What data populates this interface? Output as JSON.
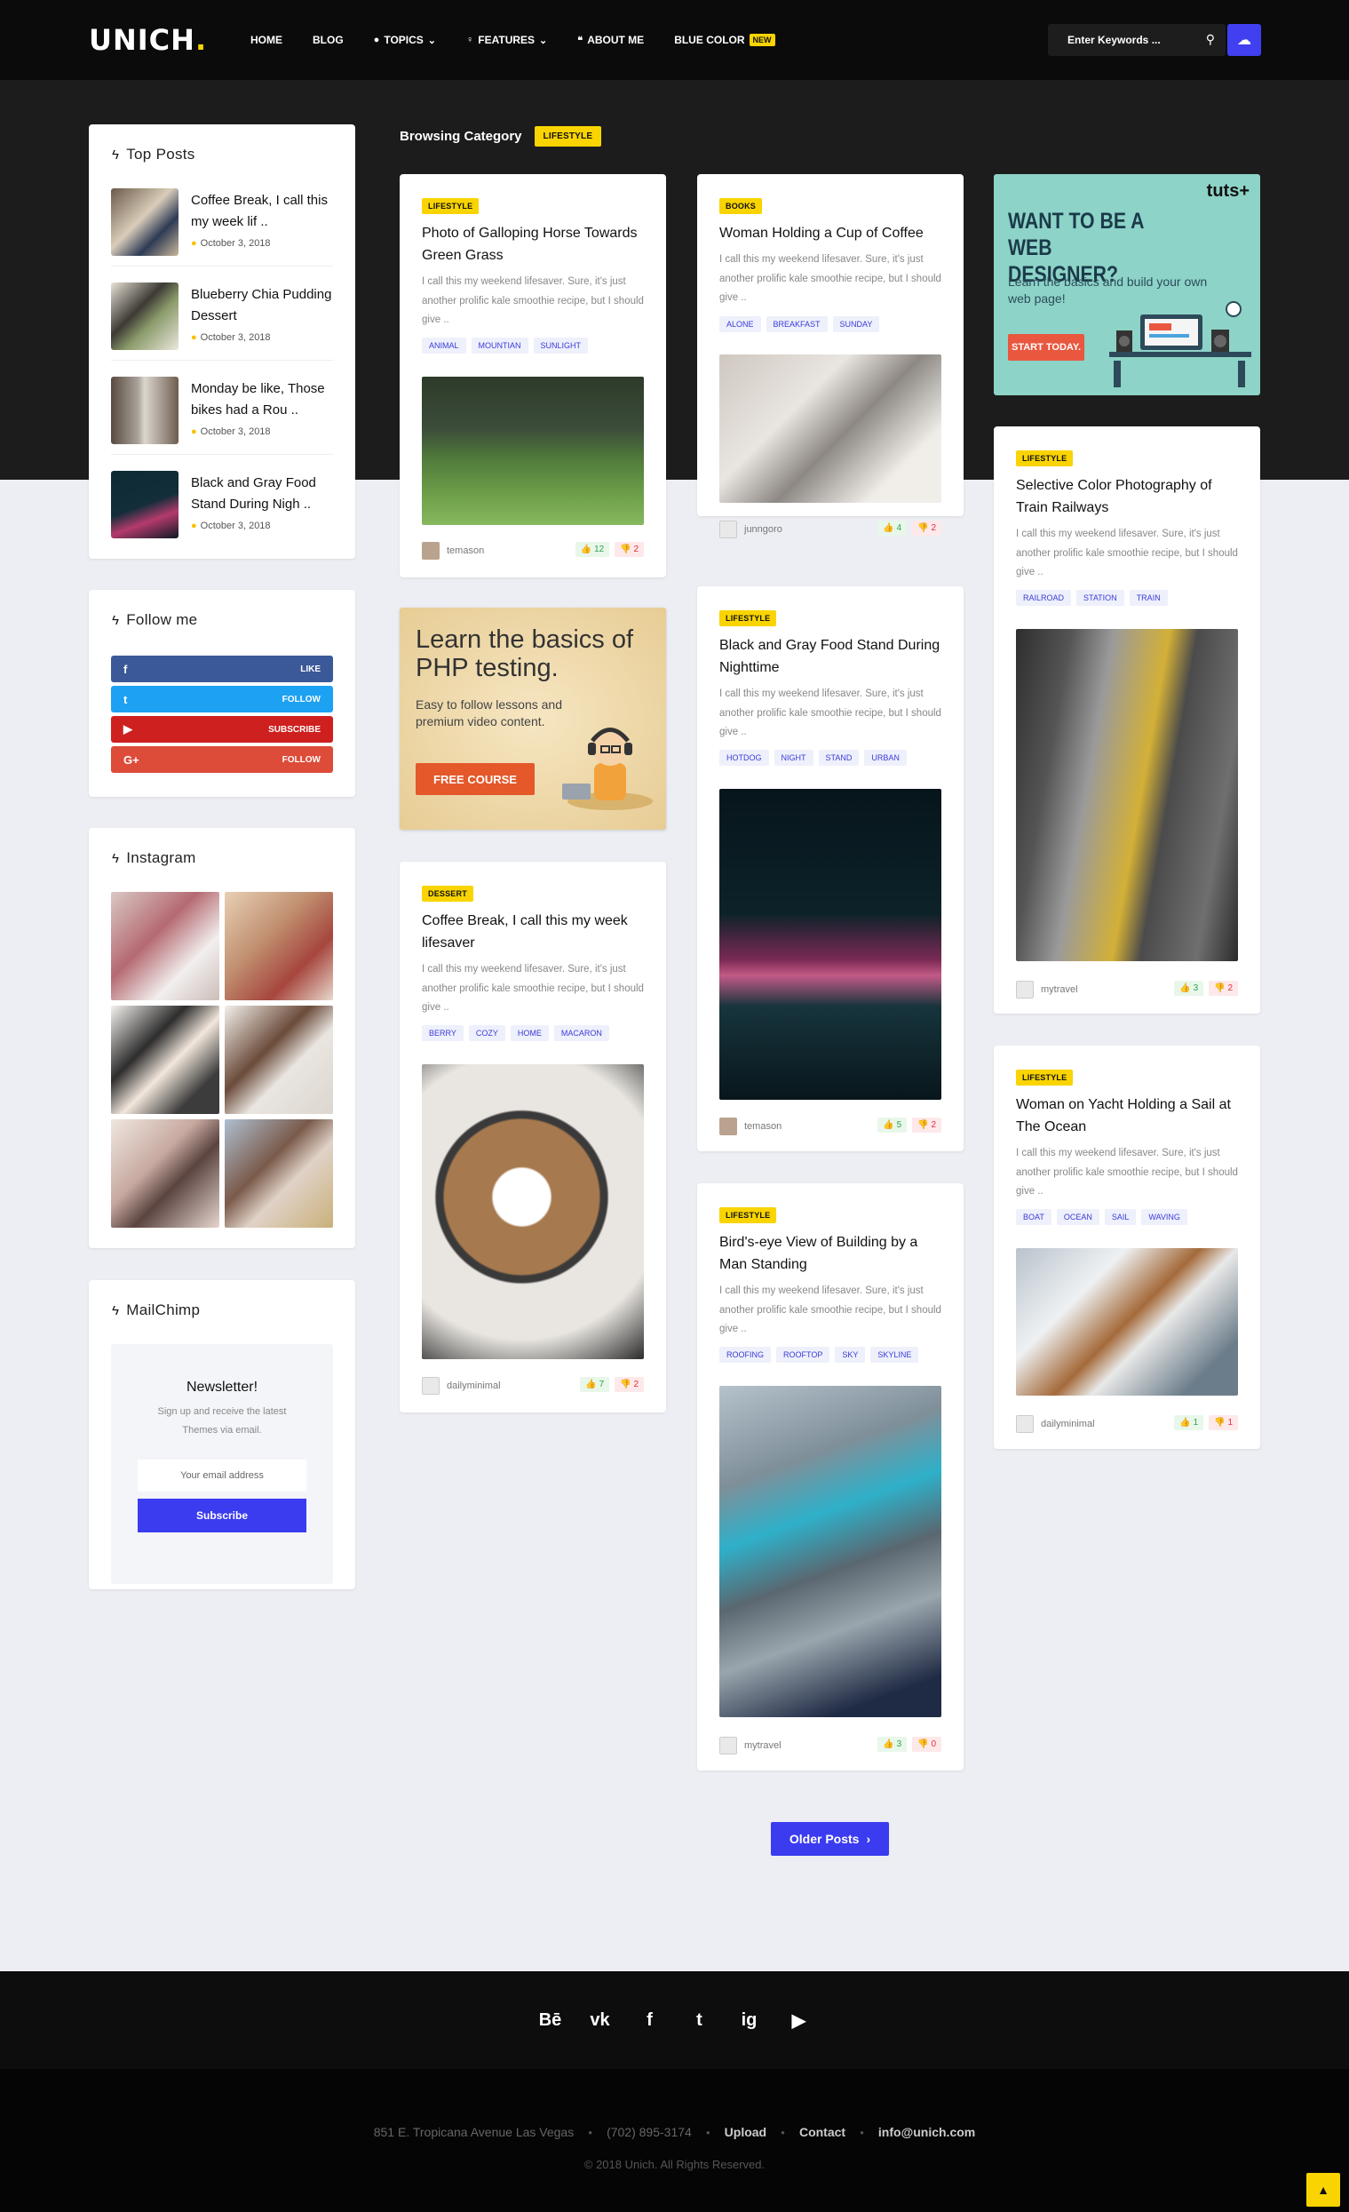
{
  "header": {
    "logo": "UNICH",
    "logo_dot": ".",
    "nav": [
      {
        "label": "HOME",
        "icon": ""
      },
      {
        "label": "BLOG",
        "icon": ""
      },
      {
        "label": "TOPICS",
        "icon": "fire-icon",
        "dropdown": true
      },
      {
        "label": "FEATURES",
        "icon": "bulb-icon",
        "dropdown": true
      },
      {
        "label": "ABOUT ME",
        "icon": "chat-icon"
      },
      {
        "label": "BLUE COLOR",
        "icon": "",
        "badge": "NEW"
      }
    ],
    "search_placeholder": "Enter Keywords ..."
  },
  "sidebar": {
    "top_posts": {
      "title": "Top Posts",
      "items": [
        {
          "title": "Coffee Break, I call this my week lif ..",
          "date": "October 3, 2018"
        },
        {
          "title": "Blueberry Chia Pudding Dessert",
          "date": "October 3, 2018"
        },
        {
          "title": "Monday be like, Those bikes had a Rou ..",
          "date": "October 3, 2018"
        },
        {
          "title": "Black and Gray Food Stand During Nigh ..",
          "date": "October 3, 2018"
        }
      ]
    },
    "follow": {
      "title": "Follow me",
      "buttons": [
        {
          "network": "facebook",
          "icon": "f",
          "label": "LIKE",
          "color": "#3b5998"
        },
        {
          "network": "twitter",
          "icon": "t",
          "label": "FOLLOW",
          "color": "#1da1f2"
        },
        {
          "network": "youtube",
          "icon": "▶",
          "label": "SUBSCRIBE",
          "color": "#cd201f"
        },
        {
          "network": "google-plus",
          "icon": "G+",
          "label": "FOLLOW",
          "color": "#dd4b39"
        }
      ]
    },
    "instagram": {
      "title": "Instagram"
    },
    "mailchimp": {
      "title": "MailChimp",
      "heading": "Newsletter!",
      "text": "Sign up and receive the latest Themes via email.",
      "email_placeholder": "Your email address",
      "button": "Subscribe"
    }
  },
  "category": {
    "label": "Browsing Category",
    "badge": "LIFESTYLE"
  },
  "posts": [
    {
      "category": "LIFESTYLE",
      "title": "Photo of Galloping Horse Towards Green Grass",
      "excerpt": "I call this my weekend lifesaver. Sure, it's just another prolific kale smoothie recipe, but I should give ..",
      "tags": [
        "ANIMAL",
        "MOUNTIAN",
        "SUNLIGHT"
      ],
      "author": "temason",
      "up": "12",
      "down": "2"
    },
    {
      "category": "DESSERT",
      "title": "Coffee Break, I call this my week lifesaver",
      "excerpt": "I call this my weekend lifesaver. Sure, it's just another prolific kale smoothie recipe, but I should give ..",
      "tags": [
        "BERRY",
        "COZY",
        "HOME",
        "MACARON"
      ],
      "author": "dailyminimal",
      "up": "7",
      "down": "2"
    },
    {
      "category": "BOOKS",
      "title": "Woman Holding a Cup of Coffee",
      "excerpt": "I call this my weekend lifesaver. Sure, it's just another prolific kale smoothie recipe, but I should give ..",
      "tags": [
        "ALONE",
        "BREAKFAST",
        "SUNDAY"
      ],
      "author": "junngoro",
      "up": "4",
      "down": "2"
    },
    {
      "category": "LIFESTYLE",
      "title": "Black and Gray Food Stand During Nighttime",
      "excerpt": "I call this my weekend lifesaver. Sure, it's just another prolific kale smoothie recipe, but I should give ..",
      "tags": [
        "HOTDOG",
        "NIGHT",
        "STAND",
        "URBAN"
      ],
      "author": "temason",
      "up": "5",
      "down": "2"
    },
    {
      "category": "LIFESTYLE",
      "title": "Bird's-eye View of Building by a Man Standing",
      "excerpt": "I call this my weekend lifesaver. Sure, it's just another prolific kale smoothie recipe, but I should give ..",
      "tags": [
        "ROOFING",
        "ROOFTOP",
        "SKY",
        "SKYLINE"
      ],
      "author": "mytravel",
      "up": "3",
      "down": "0"
    },
    {
      "category": "LIFESTYLE",
      "title": "Selective Color Photography of Train Railways",
      "excerpt": "I call this my weekend lifesaver. Sure, it's just another prolific kale smoothie recipe, but I should give ..",
      "tags": [
        "RAILROAD",
        "STATION",
        "TRAIN"
      ],
      "author": "mytravel",
      "up": "3",
      "down": "2"
    },
    {
      "category": "LIFESTYLE",
      "title": "Woman on Yacht Holding a Sail at The Ocean",
      "excerpt": "I call this my weekend lifesaver. Sure, it's just another prolific kale smoothie recipe, but I should give ..",
      "tags": [
        "BOAT",
        "OCEAN",
        "SAIL",
        "WAVING"
      ],
      "author": "dailyminimal",
      "up": "1",
      "down": "1"
    }
  ],
  "ads": {
    "php": {
      "title": "Learn the basics of PHP testing.",
      "sub": "Easy to follow lessons and premium video content.",
      "button": "FREE COURSE"
    },
    "tuts": {
      "logo": "tuts+",
      "title": "WANT TO BE A WEB DESIGNER?",
      "sub": "Learn the basics and build your own web page!",
      "button": "START TODAY."
    }
  },
  "pagination": {
    "older": "Older Posts"
  },
  "footer": {
    "social": [
      "Bē",
      "vk",
      "f",
      "t",
      "ig",
      "▶"
    ],
    "address": "851 E. Tropicana Avenue Las Vegas",
    "phone": "(702) 895-3174",
    "upload": "Upload",
    "contact": "Contact",
    "email": "info@unich.com",
    "copyright": "© 2018 Unich. All Rights Reserved."
  }
}
